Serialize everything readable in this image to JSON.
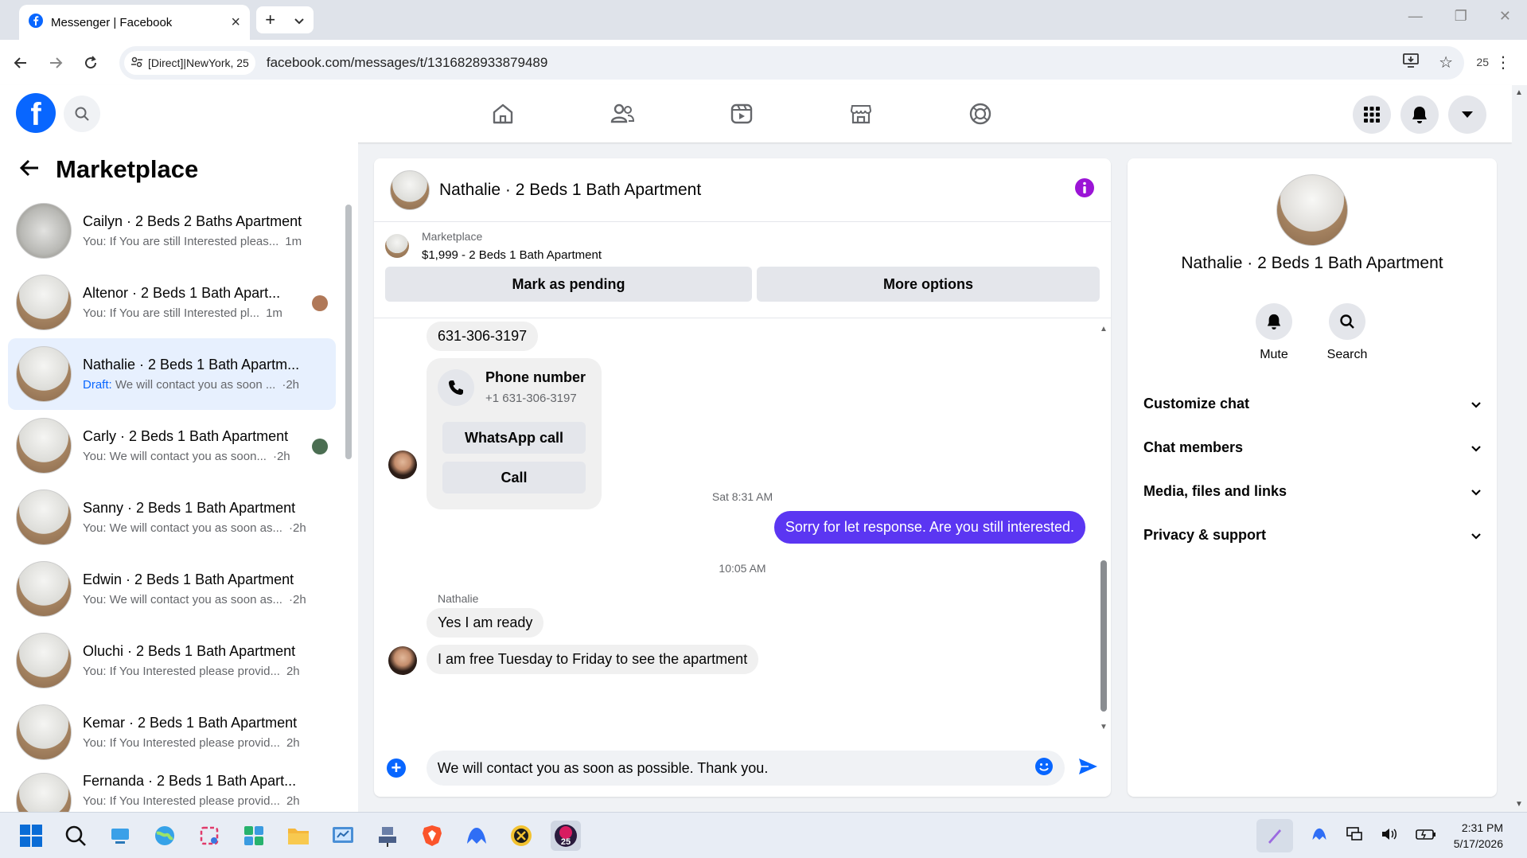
{
  "browser": {
    "tab_title": "Messenger | Facebook",
    "site_chip": "[Direct]|NewYork, 25",
    "url": "facebook.com/messages/t/1316828933879489",
    "ext_badge": "25"
  },
  "left": {
    "title": "Marketplace",
    "conversations": [
      {
        "name": "Cailyn · 2 Beds 2 Baths Apartment",
        "preview": "You: If You are still Interested pleas...",
        "time": "1m",
        "draft": ""
      },
      {
        "name": "Altenor · 2 Beds 1 Bath Apart...",
        "preview": "You: If You are still Interested pl...",
        "time": "1m",
        "draft": ""
      },
      {
        "name": "Nathalie · 2 Beds 1 Bath Apartm...",
        "preview": "We will contact you as soon ...",
        "time": "·2h",
        "draft": "Draft:"
      },
      {
        "name": "Carly · 2 Beds 1 Bath Apartment",
        "preview": "You: We will contact you as soon...",
        "time": "·2h",
        "draft": ""
      },
      {
        "name": "Sanny · 2 Beds 1 Bath Apartment",
        "preview": "You: We will contact you as soon as...",
        "time": "·2h",
        "draft": ""
      },
      {
        "name": "Edwin · 2 Beds 1 Bath Apartment",
        "preview": "You: We will contact you as soon as...",
        "time": "·2h",
        "draft": ""
      },
      {
        "name": "Oluchi · 2 Beds 1 Bath Apartment",
        "preview": "You: If You Interested please provid...",
        "time": "2h",
        "draft": ""
      },
      {
        "name": "Kemar · 2 Beds 1 Bath Apartment",
        "preview": "You: If You Interested please provid...",
        "time": "2h",
        "draft": ""
      },
      {
        "name": "Fernanda · 2 Beds 1 Bath Apart...",
        "preview": "You: If You Interested please provid...",
        "time": "2h",
        "draft": ""
      }
    ]
  },
  "chat": {
    "title": "Nathalie · 2 Beds 1 Bath Apartment",
    "marketplace_label": "Marketplace",
    "listing": "$1,999 - 2 Beds 1 Bath Apartment",
    "btn_pending": "Mark as pending",
    "btn_more": "More options",
    "phone_bubble": "631-306-3197",
    "card_title": "Phone number",
    "card_value": "+1 631-306-3197",
    "btn_whatsapp": "WhatsApp call",
    "btn_call": "Call",
    "ts1": "Sat 8:31 AM",
    "out_msg": "Sorry for let response. Are you still interested.",
    "ts2": "10:05 AM",
    "sender": "Nathalie",
    "in_msg1": "Yes I am ready",
    "in_msg2": "I am free Tuesday to Friday to see the apartment",
    "composer_text": "We will contact you as soon as possible. Thank you."
  },
  "right": {
    "name": "Nathalie · 2 Beds 1 Bath Apartment",
    "mute": "Mute",
    "search": "Search",
    "sections": [
      "Customize chat",
      "Chat members",
      "Media, files and links",
      "Privacy & support"
    ]
  },
  "taskbar": {
    "time": "2:31 PM",
    "date": "5/17/2026",
    "badge": "25"
  },
  "colors": {
    "fb_blue": "#0866ff",
    "outgoing_bubble": "#5b36f2",
    "info_purple": "#9b14d6"
  }
}
